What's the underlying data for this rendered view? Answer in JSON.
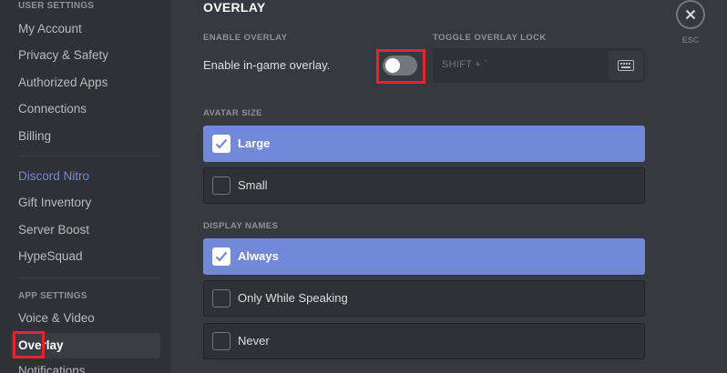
{
  "sidebar": {
    "user_settings_header": "USER SETTINGS",
    "user_items": [
      {
        "label": "My Account"
      },
      {
        "label": "Privacy & Safety"
      },
      {
        "label": "Authorized Apps"
      },
      {
        "label": "Connections"
      },
      {
        "label": "Billing"
      }
    ],
    "nitro_items": [
      {
        "label": "Discord Nitro"
      },
      {
        "label": "Gift Inventory"
      },
      {
        "label": "Server Boost"
      },
      {
        "label": "HypeSquad"
      }
    ],
    "app_settings_header": "APP SETTINGS",
    "app_items": [
      {
        "label": "Voice & Video"
      },
      {
        "label": "Overlay"
      },
      {
        "label": "Notifications"
      }
    ],
    "active_item": "Overlay"
  },
  "overlay": {
    "title": "OVERLAY",
    "enable_header": "ENABLE OVERLAY",
    "enable_label": "Enable in-game overlay.",
    "enable_on": false,
    "lock_header": "TOGGLE OVERLAY LOCK",
    "lock_keys": "SHIFT + `",
    "avatar_size_header": "AVATAR SIZE",
    "avatar_options": [
      {
        "label": "Large",
        "selected": true
      },
      {
        "label": "Small",
        "selected": false
      }
    ],
    "display_names_header": "DISPLAY NAMES",
    "display_options": [
      {
        "label": "Always",
        "selected": true
      },
      {
        "label": "Only While Speaking",
        "selected": false
      },
      {
        "label": "Never",
        "selected": false
      }
    ]
  },
  "close": {
    "esc_label": "ESC"
  },
  "colors": {
    "accent": "#7289da",
    "highlight": "#e5252b",
    "background": "#36393f",
    "sidebar": "#2f3136"
  },
  "icons": [
    "close-icon",
    "keyboard-icon",
    "checkmark-icon"
  ]
}
